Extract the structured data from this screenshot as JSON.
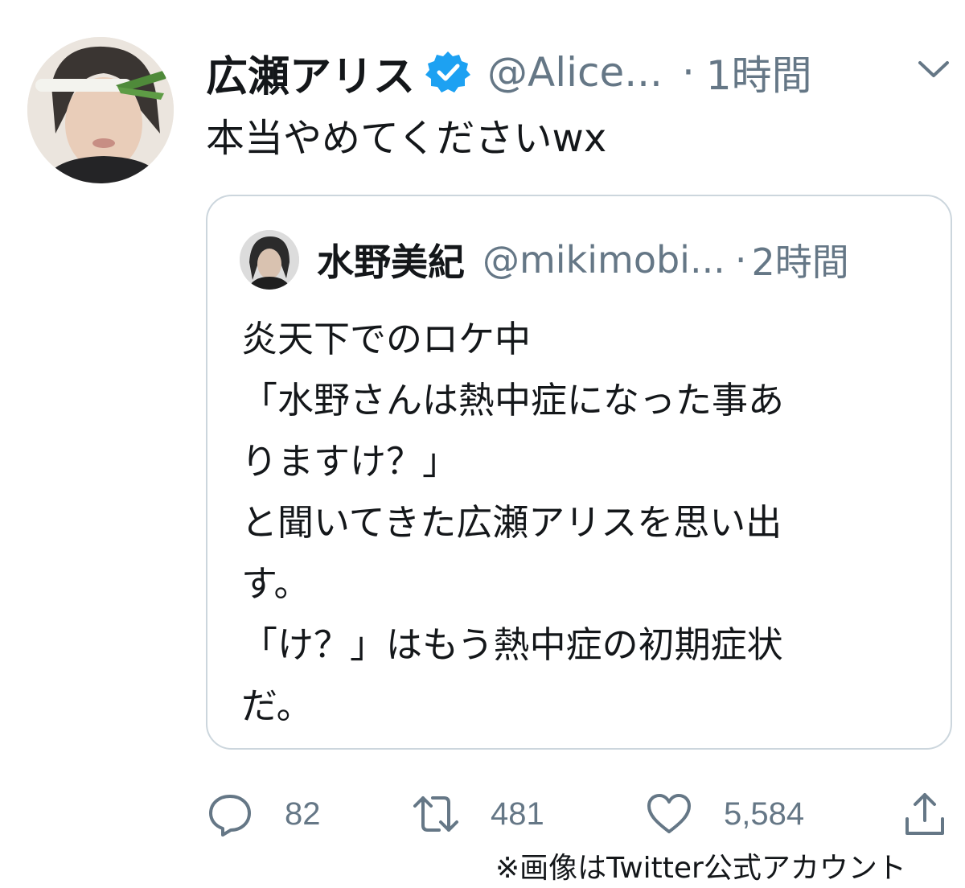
{
  "tweet": {
    "display_name": "広瀬アリス",
    "handle": "@Alice...",
    "separator": "·",
    "time": "1時間",
    "text": "本当やめてくださいwx",
    "avatar_icon": "user-avatar-photo",
    "verified_icon": "verified-badge-icon",
    "menu_icon": "chevron-down-icon",
    "colors": {
      "verified": "#1da1f2",
      "secondary_text": "#657786",
      "border": "#ccd6dd"
    }
  },
  "quoted": {
    "display_name": "水野美紀",
    "handle": "@mikimobi...",
    "separator": "·",
    "time": "2時間",
    "lines": [
      "炎天下でのロケ中",
      "「水野さんは熱中症になった事あ",
      "りますけ？」",
      "と聞いてきた広瀬アリスを思い出",
      "す。",
      "「け？」はもう熱中症の初期症状",
      "だ。"
    ]
  },
  "actions": {
    "reply": {
      "icon": "reply-icon",
      "count": "82"
    },
    "retweet": {
      "icon": "retweet-icon",
      "count": "481"
    },
    "like": {
      "icon": "heart-icon",
      "count": "5,584"
    },
    "share": {
      "icon": "share-icon"
    }
  },
  "caption": "※画像はTwitter公式アカウント"
}
